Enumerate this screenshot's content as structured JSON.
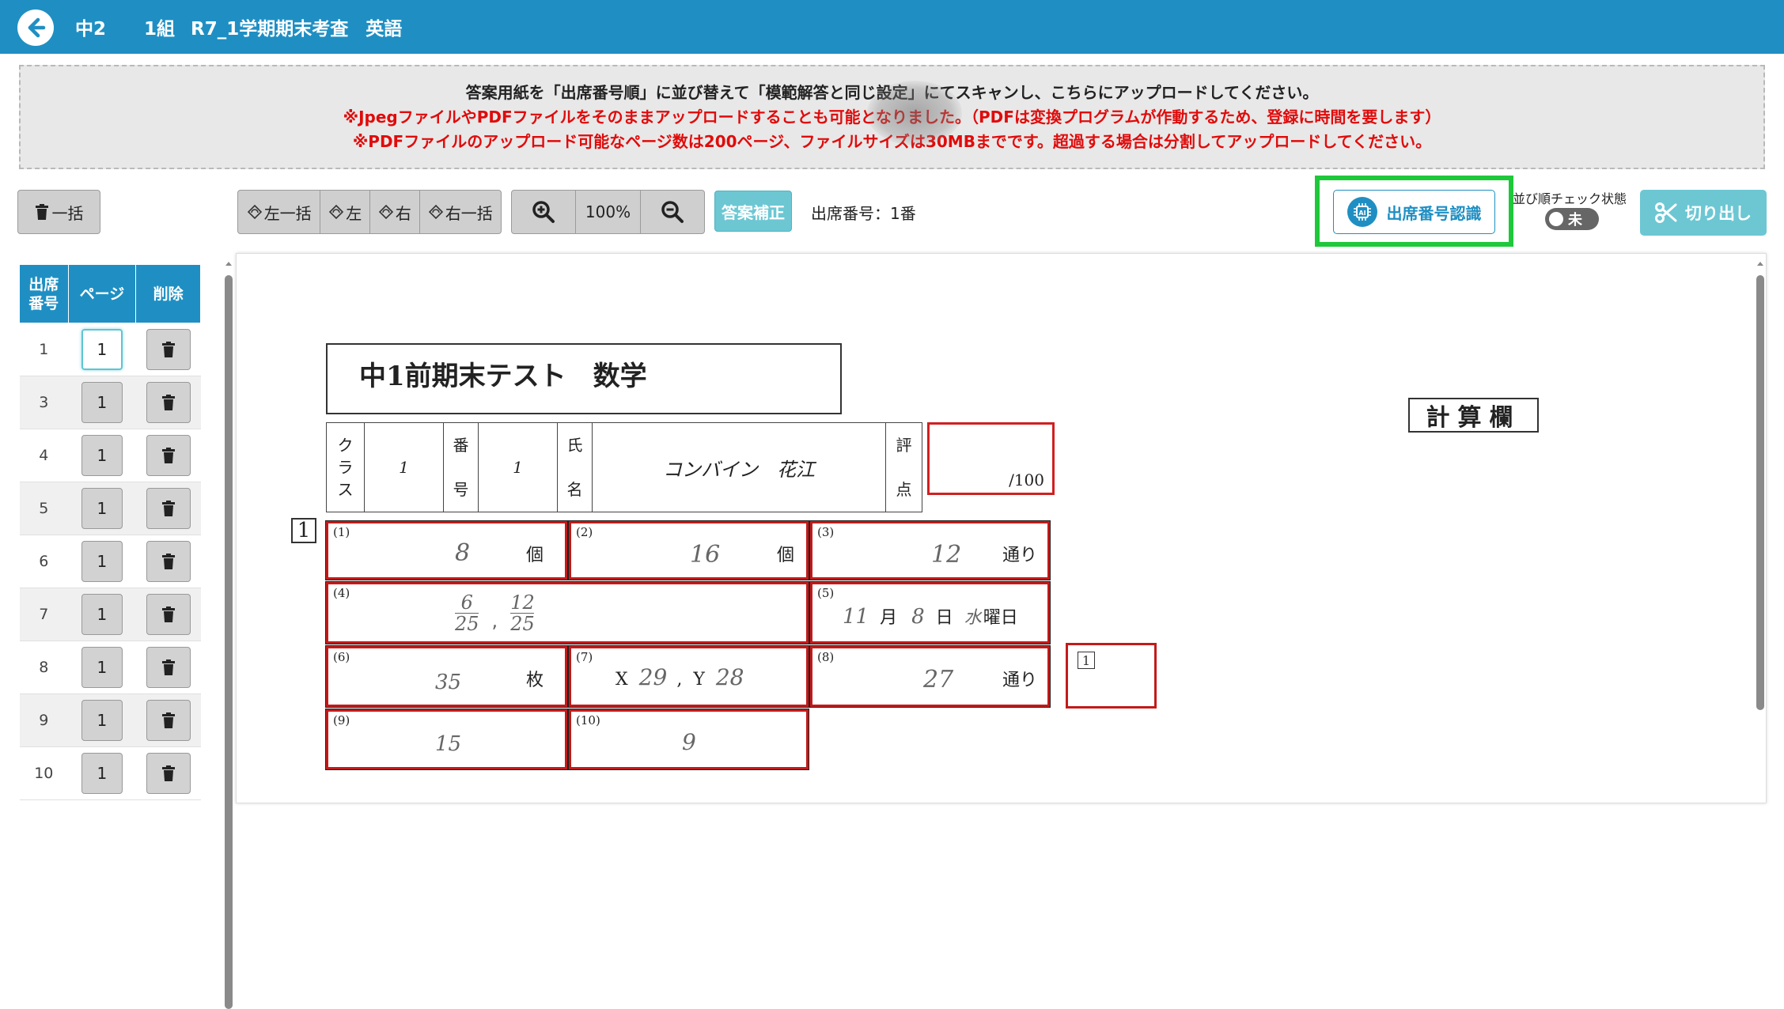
{
  "header": {
    "crumbs": [
      "中2",
      "1組",
      "R7_1学期期末考査",
      "英語"
    ]
  },
  "notice": {
    "line1": "答案用紙を「出席番号順」に並び替えて「模範解答と同じ設定」にてスキャンし、こちらにアップロードしてください。",
    "line2": "※JpegファイルやPDFファイルをそのままアップロードすることも可能となりました。（PDFは変換プログラムが作動するため、登録に時間を要します）",
    "line3": "※PDFファイルのアップロード可能なページ数は200ページ、ファイルサイズは30MBまでです。超過する場合は分割してアップロードしてください。"
  },
  "toolbar": {
    "bulk_delete": "一括",
    "rotate": [
      "左一括",
      "左",
      "右",
      "右一括"
    ],
    "zoom_level": "100%",
    "answer_correct": "答案補正",
    "student_number_label": "出席番号：1番",
    "recognize": "出席番号認識",
    "order_check_label": "並び順チェック状態",
    "order_check_value": "未",
    "cut": "切り出し"
  },
  "table": {
    "headers": [
      "出席番号",
      "ページ",
      "削除"
    ],
    "rows": [
      {
        "no": "1",
        "page": "1"
      },
      {
        "no": "3",
        "page": "1"
      },
      {
        "no": "4",
        "page": "1"
      },
      {
        "no": "5",
        "page": "1"
      },
      {
        "no": "6",
        "page": "1"
      },
      {
        "no": "7",
        "page": "1"
      },
      {
        "no": "8",
        "page": "1"
      },
      {
        "no": "9",
        "page": "1"
      },
      {
        "no": "10",
        "page": "1"
      }
    ]
  },
  "sheet": {
    "title": "中1前期末テスト　数学",
    "calc_label": "計算欄",
    "class_label": "クラス",
    "class_value": "1",
    "number_label": "番号",
    "number_value": "1",
    "name_label": "氏名",
    "name_value": "コンバイン　花江",
    "score_label": "評点",
    "score_max": "/100",
    "question_no": "1",
    "small_q_no": "1",
    "cells": [
      {
        "no": "(1)",
        "answer": "8",
        "unit": "個"
      },
      {
        "no": "(2)",
        "answer": "16",
        "unit": "個"
      },
      {
        "no": "(3)",
        "answer": "12",
        "unit": "通り"
      },
      {
        "no": "(4)",
        "frac1_num": "6",
        "frac1_den": "25",
        "sep": ",",
        "frac2_num": "12",
        "frac2_den": "25"
      },
      {
        "no": "(5)",
        "month": "11",
        "month_unit": "月",
        "day": "8",
        "day_unit": "日",
        "weekday": "水",
        "weekday_unit": "曜日"
      },
      {
        "no": "(6)",
        "answer": "35",
        "unit": "枚"
      },
      {
        "no": "(7)",
        "x_label": "X",
        "x_value": "29",
        "sep": ",",
        "y_label": "Y",
        "y_value": "28"
      },
      {
        "no": "(8)",
        "answer": "27",
        "unit": "通り"
      },
      {
        "no": "(9)",
        "answer": "15"
      },
      {
        "no": "(10)",
        "answer": "9"
      }
    ]
  },
  "colors": {
    "brand": "#1f8fc3",
    "highlight": "#1ec83a",
    "answer_box": "#c31a1a",
    "warning_text": "#e00b0b"
  }
}
